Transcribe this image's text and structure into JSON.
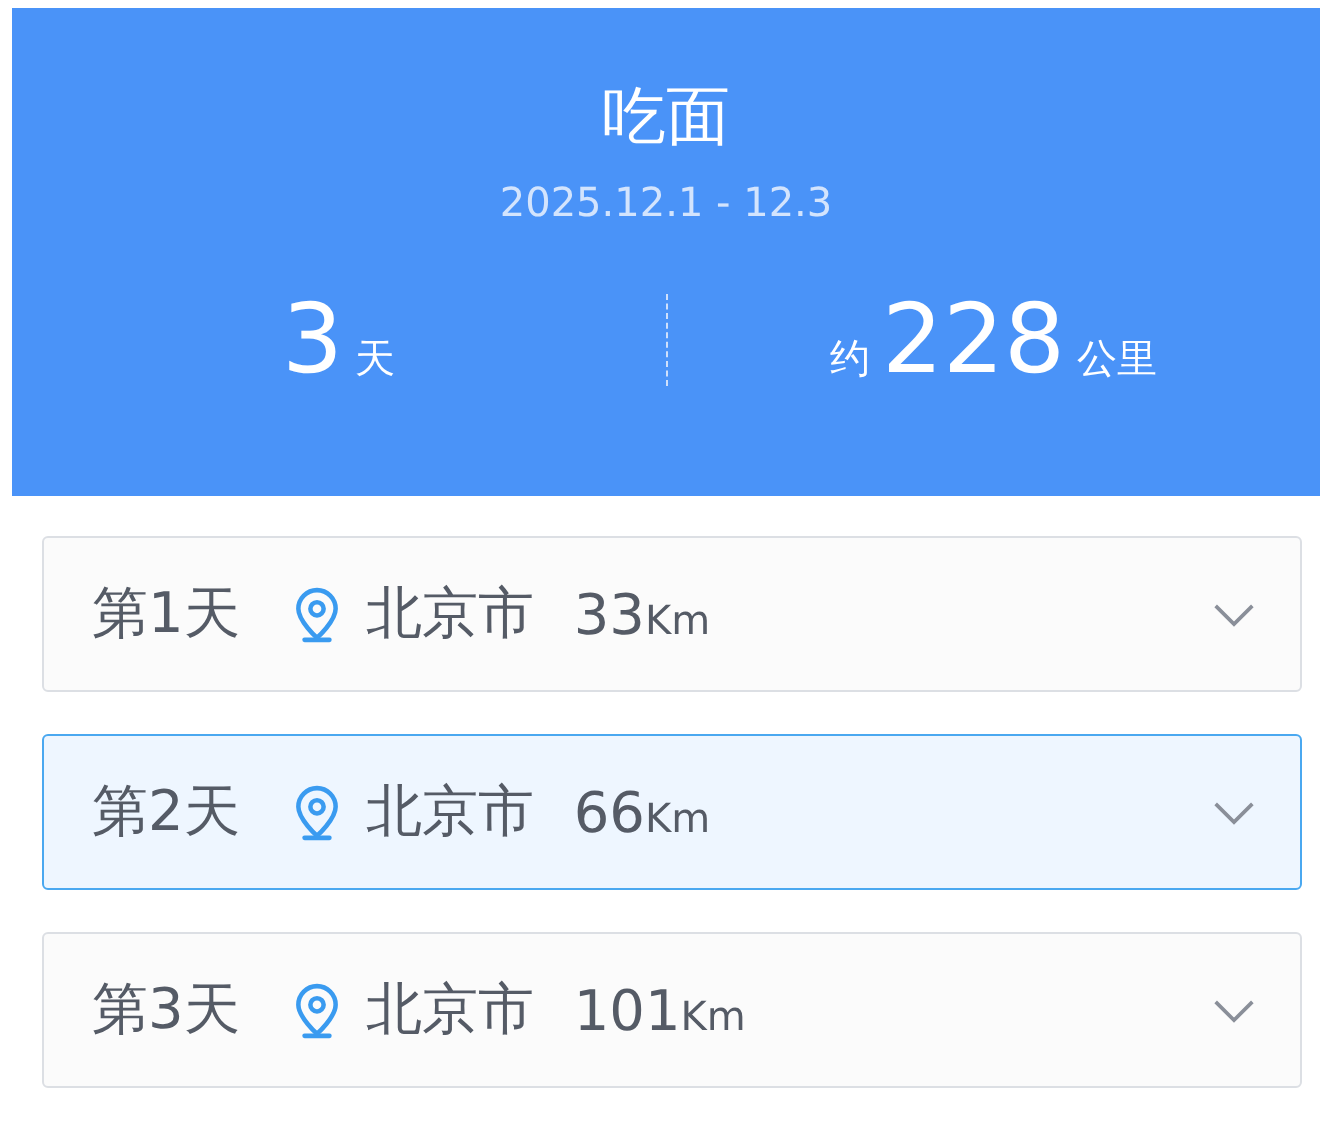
{
  "trip": {
    "title": "吃面",
    "dates": "2025.12.1 - 12.3"
  },
  "stats": [
    {
      "value": "3",
      "unit": "天"
    },
    {
      "prefix": "约",
      "value": "228",
      "unit": "公里"
    }
  ],
  "days": [
    {
      "label": "第1天",
      "city": "北京市",
      "distance": "33",
      "unit": "Km",
      "selected": false
    },
    {
      "label": "第2天",
      "city": "北京市",
      "distance": "66",
      "unit": "Km",
      "selected": true
    },
    {
      "label": "第3天",
      "city": "北京市",
      "distance": "101",
      "unit": "Km",
      "selected": false
    }
  ]
}
